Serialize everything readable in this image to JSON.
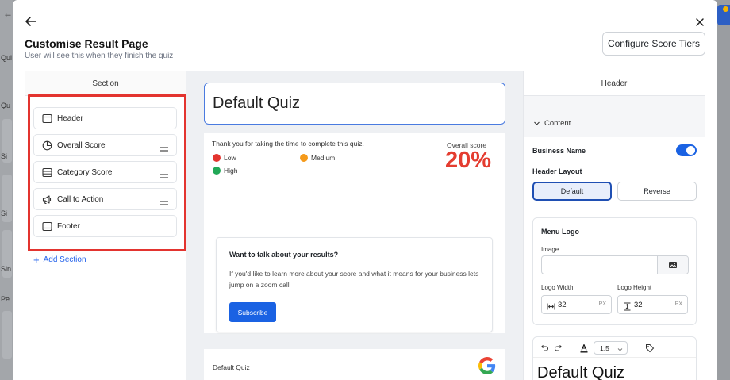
{
  "background": {
    "fragments": [
      "Qui",
      "Qu",
      "Si",
      "Si",
      "Sin",
      "Pe"
    ]
  },
  "modal": {
    "title": "Customise Result Page",
    "subtitle": "User will see this when they finish the quiz",
    "configure_button": "Configure Score Tiers"
  },
  "sections_panel": {
    "heading": "Section",
    "items": [
      {
        "label": "Header",
        "icon": "layout-header-icon",
        "draggable": false
      },
      {
        "label": "Overall Score",
        "icon": "pie-chart-icon",
        "draggable": true
      },
      {
        "label": "Category Score",
        "icon": "table-icon",
        "draggable": true
      },
      {
        "label": "Call to Action",
        "icon": "megaphone-icon",
        "draggable": true
      },
      {
        "label": "Footer",
        "icon": "layout-footer-icon",
        "draggable": false
      }
    ],
    "add_label": "Add Section"
  },
  "preview": {
    "quiz_title": "Default Quiz",
    "thanks_text": "Thank you for taking the time to complete this quiz.",
    "legend": [
      {
        "label": "Low",
        "color": "#e3342f"
      },
      {
        "label": "Medium",
        "color": "#f59a1b"
      },
      {
        "label": "High",
        "color": "#22a857"
      }
    ],
    "overall_label": "Overall score",
    "overall_value": "20%",
    "cta": {
      "title": "Want to talk about your results?",
      "body": "If you'd like to learn more about your score and what it means for your business lets jump on a zoom call",
      "button": "Subscribe"
    },
    "footer_name": "Default Quiz"
  },
  "settings_panel": {
    "heading": "Header",
    "content_label": "Content",
    "business_name_label": "Business Name",
    "business_name_enabled": true,
    "header_layout_label": "Header Layout",
    "layout_options": [
      "Default",
      "Reverse"
    ],
    "layout_selected": "Default",
    "menu_logo": {
      "title": "Menu Logo",
      "image_label": "Image",
      "width_label": "Logo Width",
      "width_value": "32",
      "height_label": "Logo Height",
      "height_value": "32",
      "unit": "PX"
    },
    "editor": {
      "line_height": "1.5",
      "preview_text": "Default Quiz"
    }
  },
  "colors": {
    "accent": "#1a62e3",
    "highlight": "#e3342f",
    "score": "#e43d30"
  }
}
